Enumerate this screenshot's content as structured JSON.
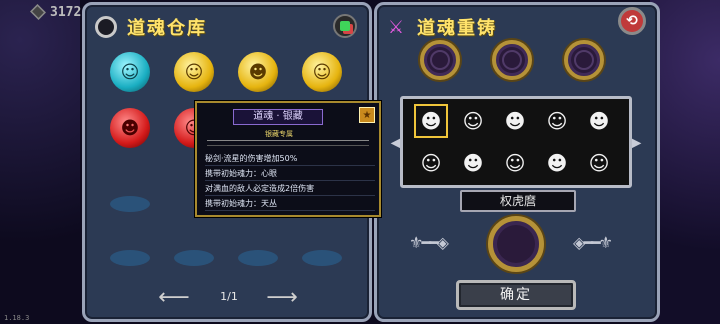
{
  "hud": {
    "gems": "3172",
    "version": "1.18.3"
  },
  "left_panel": {
    "title": "道魂仓库",
    "page_indicator": "1/1",
    "prev_icon": "arrow-left",
    "next_icon": "arrow-right",
    "souls_row1": [
      {
        "color": "#2fd3e0",
        "name": "cyan-soul"
      },
      {
        "color": "#f5cc1a",
        "name": "gold-soul"
      },
      {
        "color": "#f5cc1a",
        "name": "gold-soul"
      },
      {
        "color": "#f5cc1a",
        "name": "gold-soul"
      }
    ],
    "souls_row2": [
      {
        "color": "#e02a2a",
        "name": "red-soul"
      },
      {
        "color": "#e02a2a",
        "name": "red-soul"
      }
    ]
  },
  "tooltip": {
    "title": "道魂 · 银藏",
    "subtitle": "银藏专属",
    "lines": [
      "秘剑·流星的伤害增加50%",
      "携带初始魂力：心眼",
      "对满血的敌人必定造成2倍伤害",
      "携带初始魂力：天丛"
    ]
  },
  "right_panel": {
    "title": "道魂重铸",
    "selected_name": "权虎麿",
    "confirm_label": "确定",
    "characters": [
      {
        "glyph": "☻",
        "selected": true
      },
      {
        "glyph": "☺",
        "selected": false
      },
      {
        "glyph": "☻",
        "selected": false
      },
      {
        "glyph": "☺",
        "selected": false
      },
      {
        "glyph": "☻",
        "selected": false
      },
      {
        "glyph": "☺",
        "selected": false
      },
      {
        "glyph": "☻",
        "selected": false
      },
      {
        "glyph": "☺",
        "selected": false
      },
      {
        "glyph": "☻",
        "selected": false
      },
      {
        "glyph": "☺",
        "selected": false
      }
    ]
  },
  "colors": {
    "panel_bg": "#2c3a54",
    "title_yellow": "#ffe36b",
    "gold_border": "#b59238"
  }
}
